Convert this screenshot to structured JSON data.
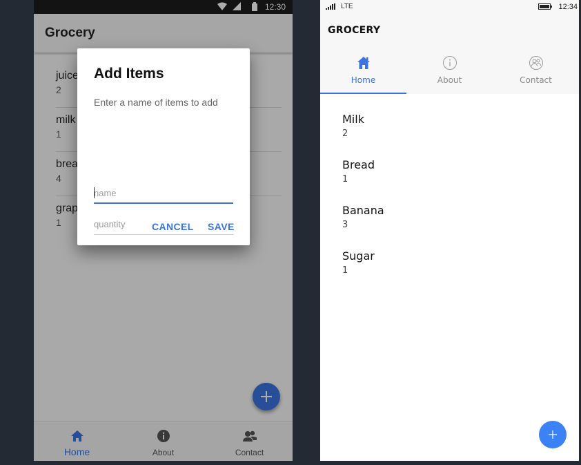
{
  "android": {
    "status": {
      "time": "12:30",
      "icons": [
        "wifi-icon",
        "signal-icon",
        "battery-icon"
      ]
    },
    "app_title": "Grocery",
    "items": [
      {
        "name": "juice",
        "quantity": "2"
      },
      {
        "name": "milk",
        "quantity": "1"
      },
      {
        "name": "bread",
        "quantity": "4"
      },
      {
        "name": "grapes",
        "quantity": "1"
      }
    ],
    "dialog": {
      "title": "Add Items",
      "message": "Enter a name of items to add",
      "name_placeholder": "name",
      "quantity_placeholder": "quantity",
      "cancel_label": "CANCEL",
      "save_label": "SAVE"
    },
    "tabs": [
      {
        "label": "Home",
        "icon": "home-icon",
        "active": true
      },
      {
        "label": "About",
        "icon": "info-icon",
        "active": false
      },
      {
        "label": "Contact",
        "icon": "contacts-icon",
        "active": false
      }
    ]
  },
  "web": {
    "status": {
      "network": "LTE",
      "time": "12:34"
    },
    "app_title": "GROCERY",
    "tabs": [
      {
        "label": "Home",
        "icon": "home-icon",
        "active": true
      },
      {
        "label": "About",
        "icon": "info-icon",
        "active": false
      },
      {
        "label": "Contact",
        "icon": "contacts-icon",
        "active": false
      }
    ],
    "items": [
      {
        "name": "Milk",
        "quantity": "2"
      },
      {
        "name": "Bread",
        "quantity": "1"
      },
      {
        "name": "Banana",
        "quantity": "3"
      },
      {
        "name": "Sugar",
        "quantity": "1"
      }
    ]
  },
  "colors": {
    "accent": "#3b73e0",
    "fab_web": "#3b82f6",
    "backdrop": "#232a33"
  }
}
